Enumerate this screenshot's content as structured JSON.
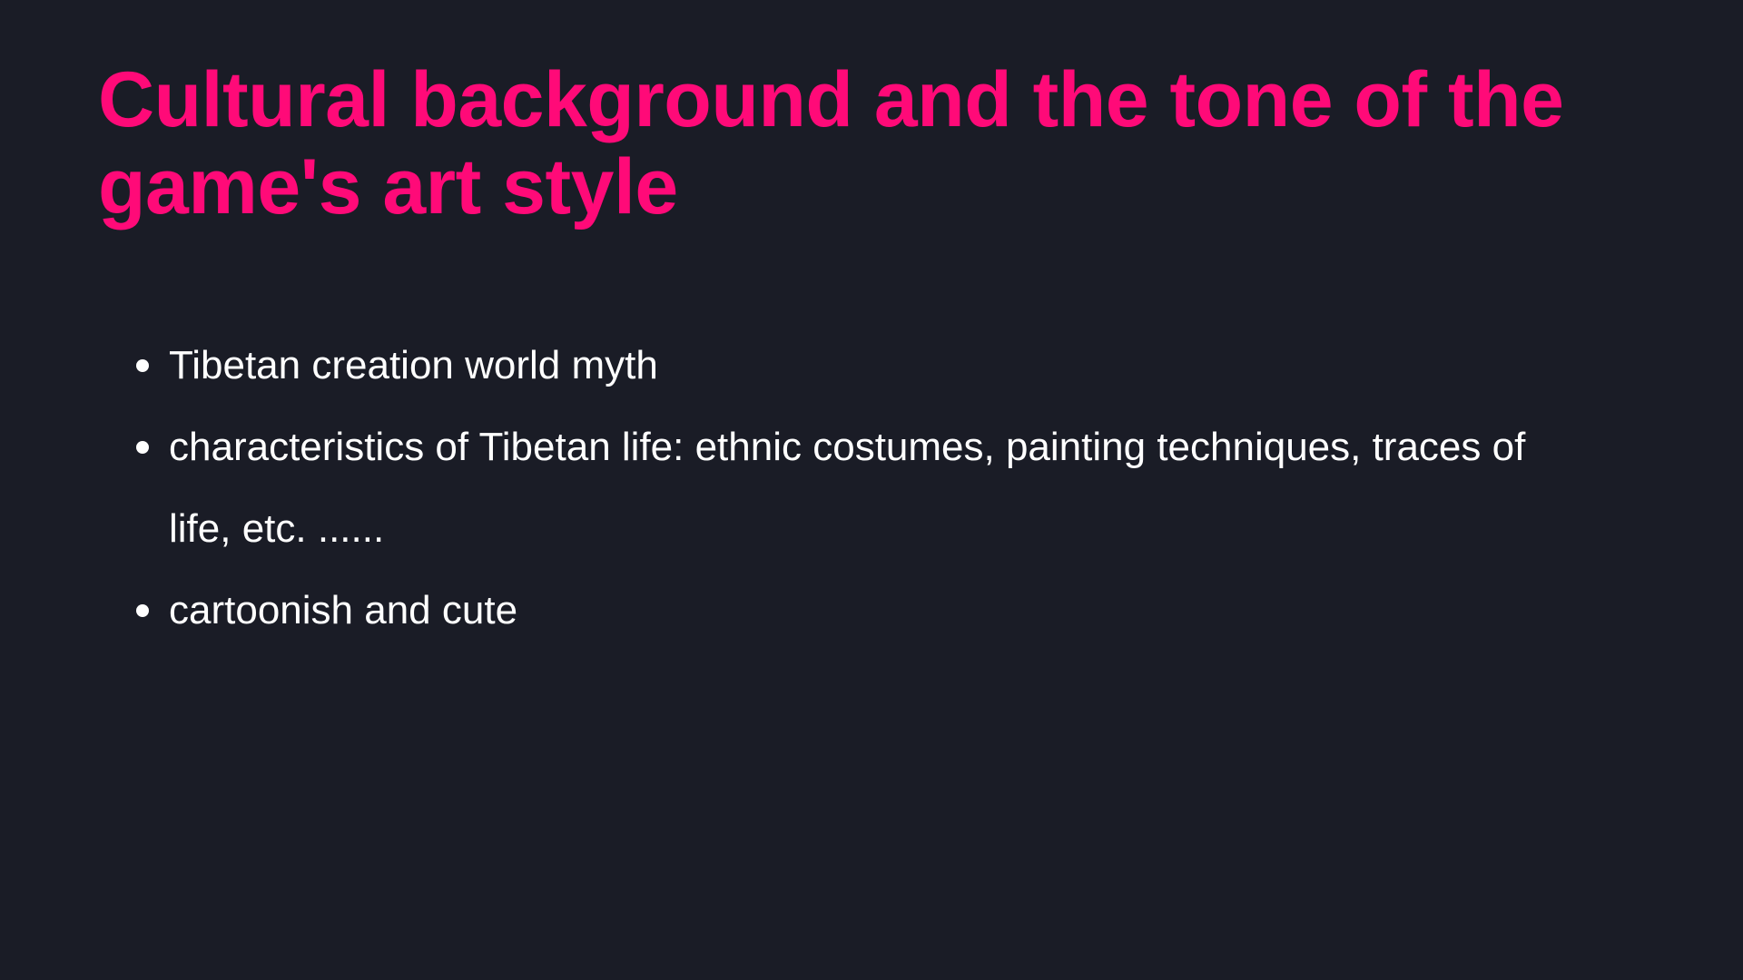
{
  "slide": {
    "title": "Cultural background and the tone of the game's art style",
    "bullets": [
      "Tibetan creation world myth",
      "characteristics of Tibetan life: ethnic costumes, painting techniques, traces of life, etc. ......",
      "cartoonish and cute"
    ]
  },
  "colors": {
    "background": "#1a1c26",
    "title": "#ff0a78",
    "text": "#ffffff"
  }
}
